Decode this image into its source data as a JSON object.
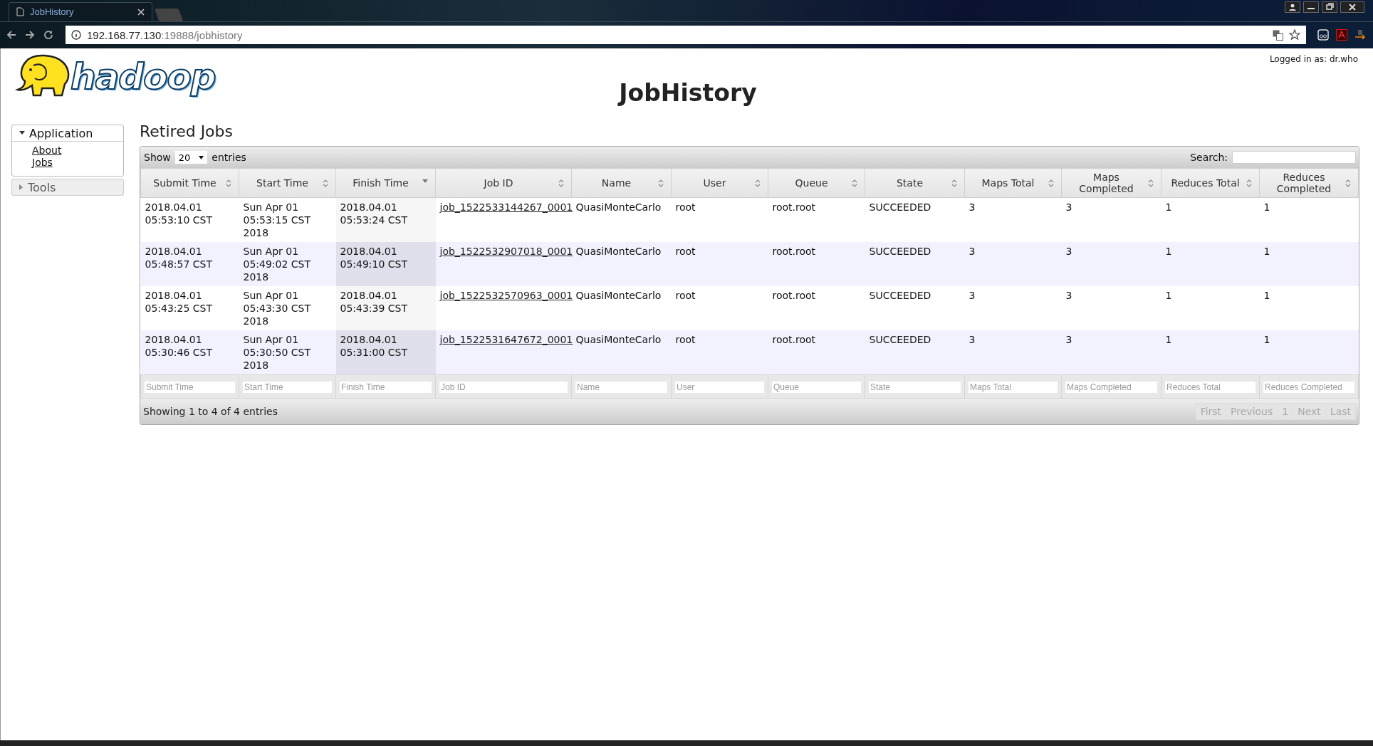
{
  "browser": {
    "tabs": [
      {
        "title": "JobHistory",
        "selected": true
      },
      {
        "selected": false
      }
    ],
    "url": {
      "host": "192.168.77.130",
      "path": ":19888/jobhistory"
    }
  },
  "header": {
    "logo_text": "hadoop",
    "title": "JobHistory",
    "login": "Logged in as: dr.who"
  },
  "sidebar": [
    {
      "label": "Application",
      "expanded": true,
      "items": [
        "About",
        "Jobs"
      ]
    },
    {
      "label": "Tools",
      "expanded": false
    }
  ],
  "section_title": "Retired Jobs",
  "length_menu": {
    "before": "Show",
    "value": "20",
    "after": "entries"
  },
  "search": {
    "label": "Search:"
  },
  "table": {
    "columns": [
      {
        "label": "Submit Time",
        "sorted": false,
        "kind": "text"
      },
      {
        "label": "Start Time",
        "sorted": false,
        "kind": "text"
      },
      {
        "label": "Finish Time",
        "sorted": true,
        "kind": "text"
      },
      {
        "label": "Job ID",
        "sorted": false,
        "kind": "link"
      },
      {
        "label": "Name",
        "sorted": false,
        "kind": "text"
      },
      {
        "label": "User",
        "sorted": false,
        "kind": "text"
      },
      {
        "label": "Queue",
        "sorted": false,
        "kind": "text"
      },
      {
        "label": "State",
        "sorted": false,
        "kind": "text"
      },
      {
        "label": "Maps Total",
        "sorted": false,
        "kind": "text"
      },
      {
        "label": "Maps Completed",
        "sorted": false,
        "kind": "text"
      },
      {
        "label": "Reduces Total",
        "sorted": false,
        "kind": "text"
      },
      {
        "label": "Reduces Completed",
        "sorted": false,
        "kind": "text"
      }
    ],
    "rows": [
      [
        "2018.04.01 05:53:10 CST",
        "Sun Apr 01 05:53:15 CST 2018",
        "2018.04.01 05:53:24 CST",
        "job_1522533144267_0001",
        "QuasiMonteCarlo",
        "root",
        "root.root",
        "SUCCEEDED",
        "3",
        "3",
        "1",
        "1"
      ],
      [
        "2018.04.01 05:48:57 CST",
        "Sun Apr 01 05:49:02 CST 2018",
        "2018.04.01 05:49:10 CST",
        "job_1522532907018_0001",
        "QuasiMonteCarlo",
        "root",
        "root.root",
        "SUCCEEDED",
        "3",
        "3",
        "1",
        "1"
      ],
      [
        "2018.04.01 05:43:25 CST",
        "Sun Apr 01 05:43:30 CST 2018",
        "2018.04.01 05:43:39 CST",
        "job_1522532570963_0001",
        "QuasiMonteCarlo",
        "root",
        "root.root",
        "SUCCEEDED",
        "3",
        "3",
        "1",
        "1"
      ],
      [
        "2018.04.01 05:30:46 CST",
        "Sun Apr 01 05:30:50 CST 2018",
        "2018.04.01 05:31:00 CST",
        "job_1522531647672_0001",
        "QuasiMonteCarlo",
        "root",
        "root.root",
        "SUCCEEDED",
        "3",
        "3",
        "1",
        "1"
      ]
    ],
    "filters": [
      {
        "placeholder": "Submit Time"
      },
      {
        "placeholder": "Start Time"
      },
      {
        "placeholder": "Finish Time"
      },
      {
        "placeholder": "Job ID"
      },
      {
        "placeholder": "Name"
      },
      {
        "placeholder": "User"
      },
      {
        "placeholder": "Queue"
      },
      {
        "placeholder": "State"
      },
      {
        "placeholder": "Maps Total"
      },
      {
        "placeholder": "Maps Completed"
      },
      {
        "placeholder": "Reduces Total"
      },
      {
        "placeholder": "Reduces Completed"
      }
    ]
  },
  "info": "Showing 1 to 4 of 4 entries",
  "pagination": [
    {
      "label": "First",
      "disabled": true
    },
    {
      "label": "Previous",
      "disabled": true
    },
    {
      "label": "1",
      "disabled": true
    },
    {
      "label": "Next",
      "disabled": true
    },
    {
      "label": "Last",
      "disabled": true
    }
  ]
}
